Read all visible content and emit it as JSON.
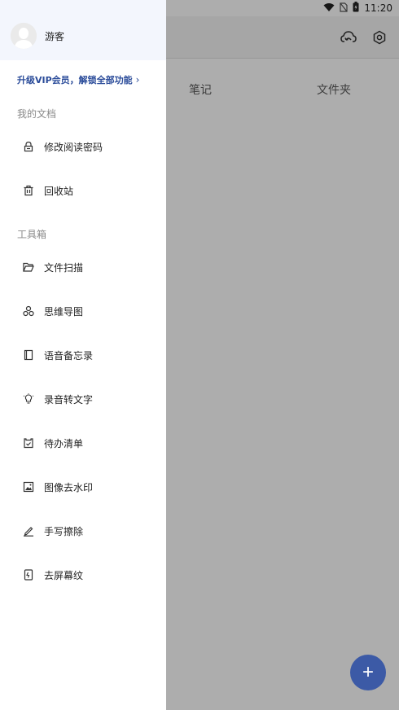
{
  "status_bar": {
    "time": "11:20"
  },
  "drawer": {
    "user_name": "游客",
    "vip_text": "升级VIP会员，解锁全部功能",
    "vip_chevron": "›",
    "sections": [
      {
        "title": "我的文档",
        "items": [
          {
            "label": "修改阅读密码",
            "icon": "lock-icon"
          },
          {
            "label": "回收站",
            "icon": "trash-icon"
          }
        ]
      },
      {
        "title": "工具箱",
        "items": [
          {
            "label": "文件扫描",
            "icon": "folder-open-icon"
          },
          {
            "label": "思维导图",
            "icon": "mind-map-icon"
          },
          {
            "label": "语音备忘录",
            "icon": "notebook-icon"
          },
          {
            "label": "录音转文字",
            "icon": "lightbulb-icon"
          },
          {
            "label": "待办清单",
            "icon": "checklist-icon"
          },
          {
            "label": "图像去水印",
            "icon": "image-icon"
          },
          {
            "label": "手写擦除",
            "icon": "pen-icon"
          },
          {
            "label": "去屏幕纹",
            "icon": "screen-icon"
          }
        ]
      }
    ]
  },
  "background": {
    "tabs": [
      "笔记",
      "文件夹"
    ],
    "fab_label": "+"
  },
  "colors": {
    "accent": "#2b4c9a",
    "fab": "#3c5aa6",
    "drawer_header": "#f3f6fd"
  }
}
